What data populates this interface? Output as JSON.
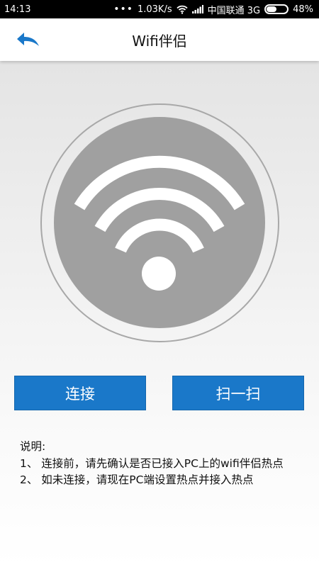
{
  "status_bar": {
    "time": "14:13",
    "speed": "1.03K/s",
    "carrier": "中国联通 3G",
    "battery": "48%",
    "battery_level": 0.48
  },
  "app_bar": {
    "title": "Wifi伴侣",
    "back_icon": "back-arrow-icon",
    "accent": "#1a78c9"
  },
  "main": {
    "wifi_icon": "wifi-icon",
    "buttons": {
      "connect": "连接",
      "scan": "扫一扫"
    },
    "notes": {
      "heading": "说明:",
      "lines": [
        "1、 连接前，请先确认是否已接入PC上的wifi伴侣热点",
        "2、 如未连接，请现在PC端设置热点并接入热点"
      ]
    }
  }
}
